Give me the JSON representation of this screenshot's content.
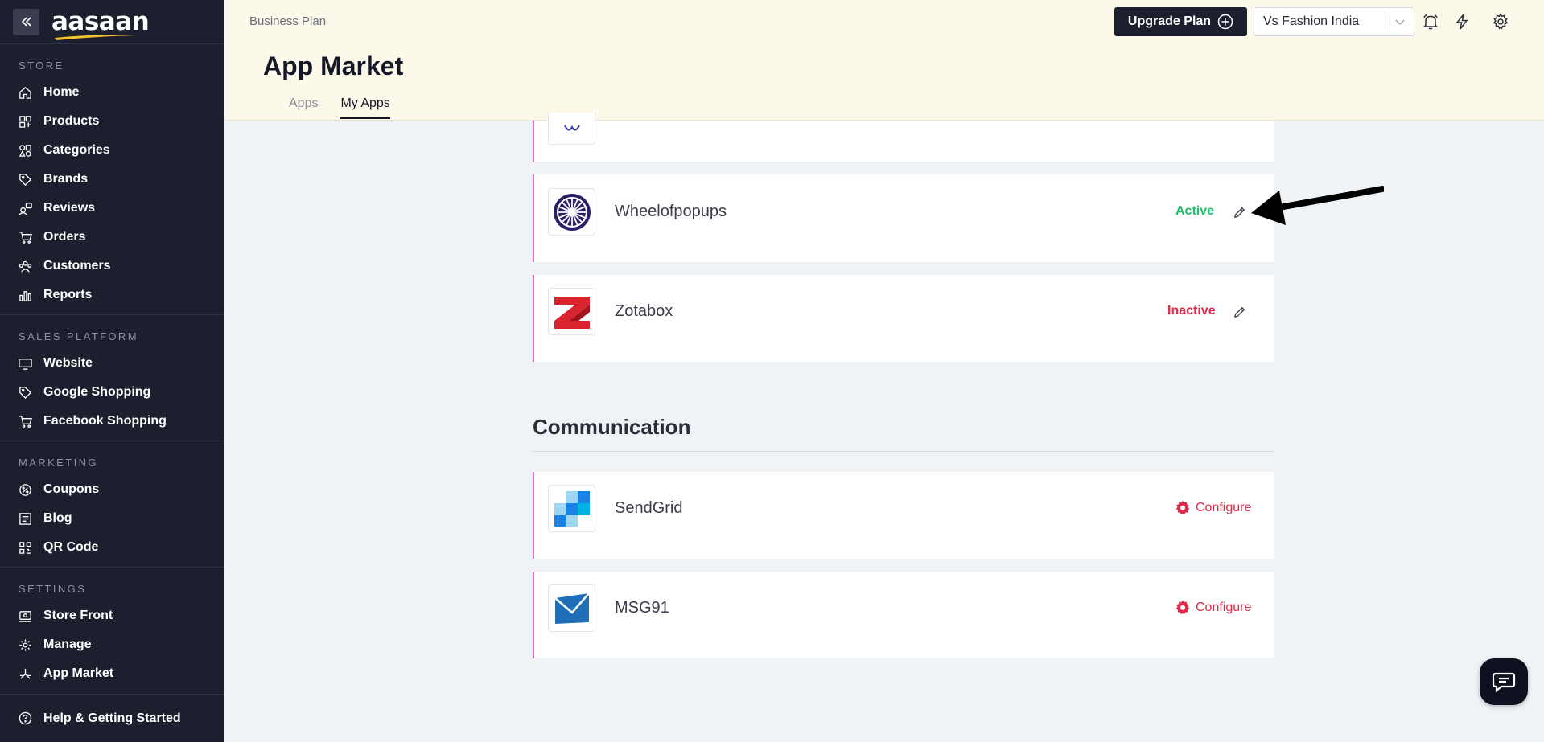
{
  "brand": {
    "logo_text": "aasaan"
  },
  "sidebar": {
    "sections": [
      {
        "heading": "STORE",
        "items": [
          {
            "label": "Home",
            "icon": "home-icon"
          },
          {
            "label": "Products",
            "icon": "products-icon"
          },
          {
            "label": "Categories",
            "icon": "categories-icon"
          },
          {
            "label": "Brands",
            "icon": "tag-icon"
          },
          {
            "label": "Reviews",
            "icon": "reviews-icon"
          },
          {
            "label": "Orders",
            "icon": "cart-icon"
          },
          {
            "label": "Customers",
            "icon": "customers-icon"
          },
          {
            "label": "Reports",
            "icon": "reports-icon"
          }
        ]
      },
      {
        "heading": "SALES PLATFORM",
        "items": [
          {
            "label": "Website",
            "icon": "monitor-icon"
          },
          {
            "label": "Google Shopping",
            "icon": "tag-icon"
          },
          {
            "label": "Facebook Shopping",
            "icon": "cart-icon"
          }
        ]
      },
      {
        "heading": "MARKETING",
        "items": [
          {
            "label": "Coupons",
            "icon": "coupon-icon"
          },
          {
            "label": "Blog",
            "icon": "blog-icon"
          },
          {
            "label": "QR Code",
            "icon": "qr-icon"
          }
        ]
      },
      {
        "heading": "SETTINGS",
        "items": [
          {
            "label": "Store Front",
            "icon": "storefront-icon"
          },
          {
            "label": "Manage",
            "icon": "gear-icon"
          },
          {
            "label": "App Market",
            "icon": "app-market-icon"
          }
        ]
      }
    ],
    "help_label": "Help & Getting Started"
  },
  "header": {
    "plan": "Business Plan",
    "title": "App Market",
    "tabs": [
      {
        "label": "Apps",
        "active": false
      },
      {
        "label": "My Apps",
        "active": true
      }
    ],
    "upgrade_label": "Upgrade Plan",
    "store_name": "Vs Fashion India"
  },
  "apps": [
    {
      "name": "Wheelofpopups",
      "status": "Active",
      "status_color": "#1fbf6a"
    },
    {
      "name": "Zotabox",
      "status": "Inactive",
      "status_color": "#e0294a"
    }
  ],
  "communication": {
    "title": "Communication",
    "apps": [
      {
        "name": "SendGrid",
        "action": "Configure"
      },
      {
        "name": "MSG91",
        "action": "Configure"
      }
    ]
  },
  "colors": {
    "accent": "#e0294a",
    "sidebar_bg": "#1c1f2e",
    "header_bg": "#fdf9ea",
    "active_green": "#1fbf6a"
  }
}
